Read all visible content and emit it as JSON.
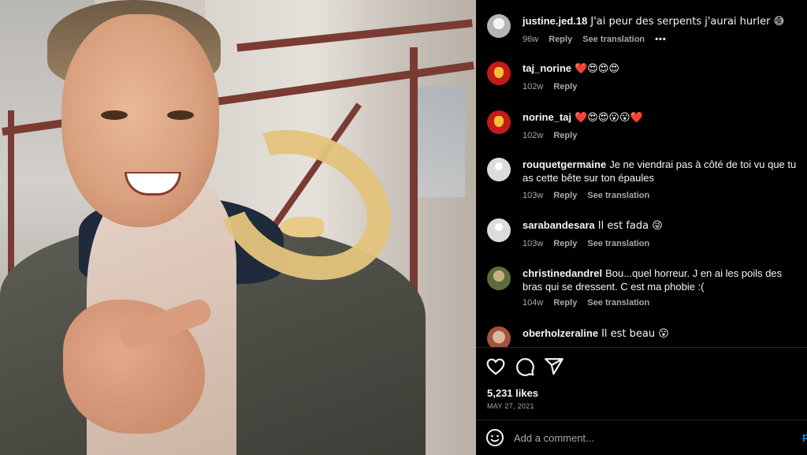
{
  "comments": [
    {
      "user": "justine.jed.18",
      "text": "J'ai peur des serpents j'aurai hurler 😅",
      "time": "96w",
      "reply": "Reply",
      "translate": "See translation",
      "more": "•••"
    },
    {
      "user": "taj_norine",
      "text": "❤️😍😍😍",
      "time": "102w",
      "reply": "Reply"
    },
    {
      "user": "norine_taj",
      "text": "❤️😍😍😮😮❤️",
      "time": "102w",
      "reply": "Reply"
    },
    {
      "user": "rouquetgermaine",
      "text": "Je ne viendrai pas à côté de toi vu que tu as cette bête sur ton épaules",
      "time": "103w",
      "reply": "Reply",
      "translate": "See translation"
    },
    {
      "user": "sarabandesara",
      "text": "Il est fada 😜",
      "time": "103w",
      "reply": "Reply",
      "translate": "See translation"
    },
    {
      "user": "christinedandrel",
      "text": "Bou...quel horreur. J en ai les poils des bras qui se dressent. C est ma phobie :(",
      "time": "104w",
      "reply": "Reply",
      "translate": "See translation"
    },
    {
      "user": "oberholzeraline",
      "text": "Il est beau 😮"
    }
  ],
  "post": {
    "likes": "5,231 likes",
    "date": "MAY 27, 2021"
  },
  "add_comment": {
    "placeholder": "Add a comment...",
    "post_label": "P"
  },
  "icons": {
    "like": "heart-icon",
    "comment": "comment-icon",
    "share": "share-icon",
    "emoji": "emoji-icon"
  }
}
